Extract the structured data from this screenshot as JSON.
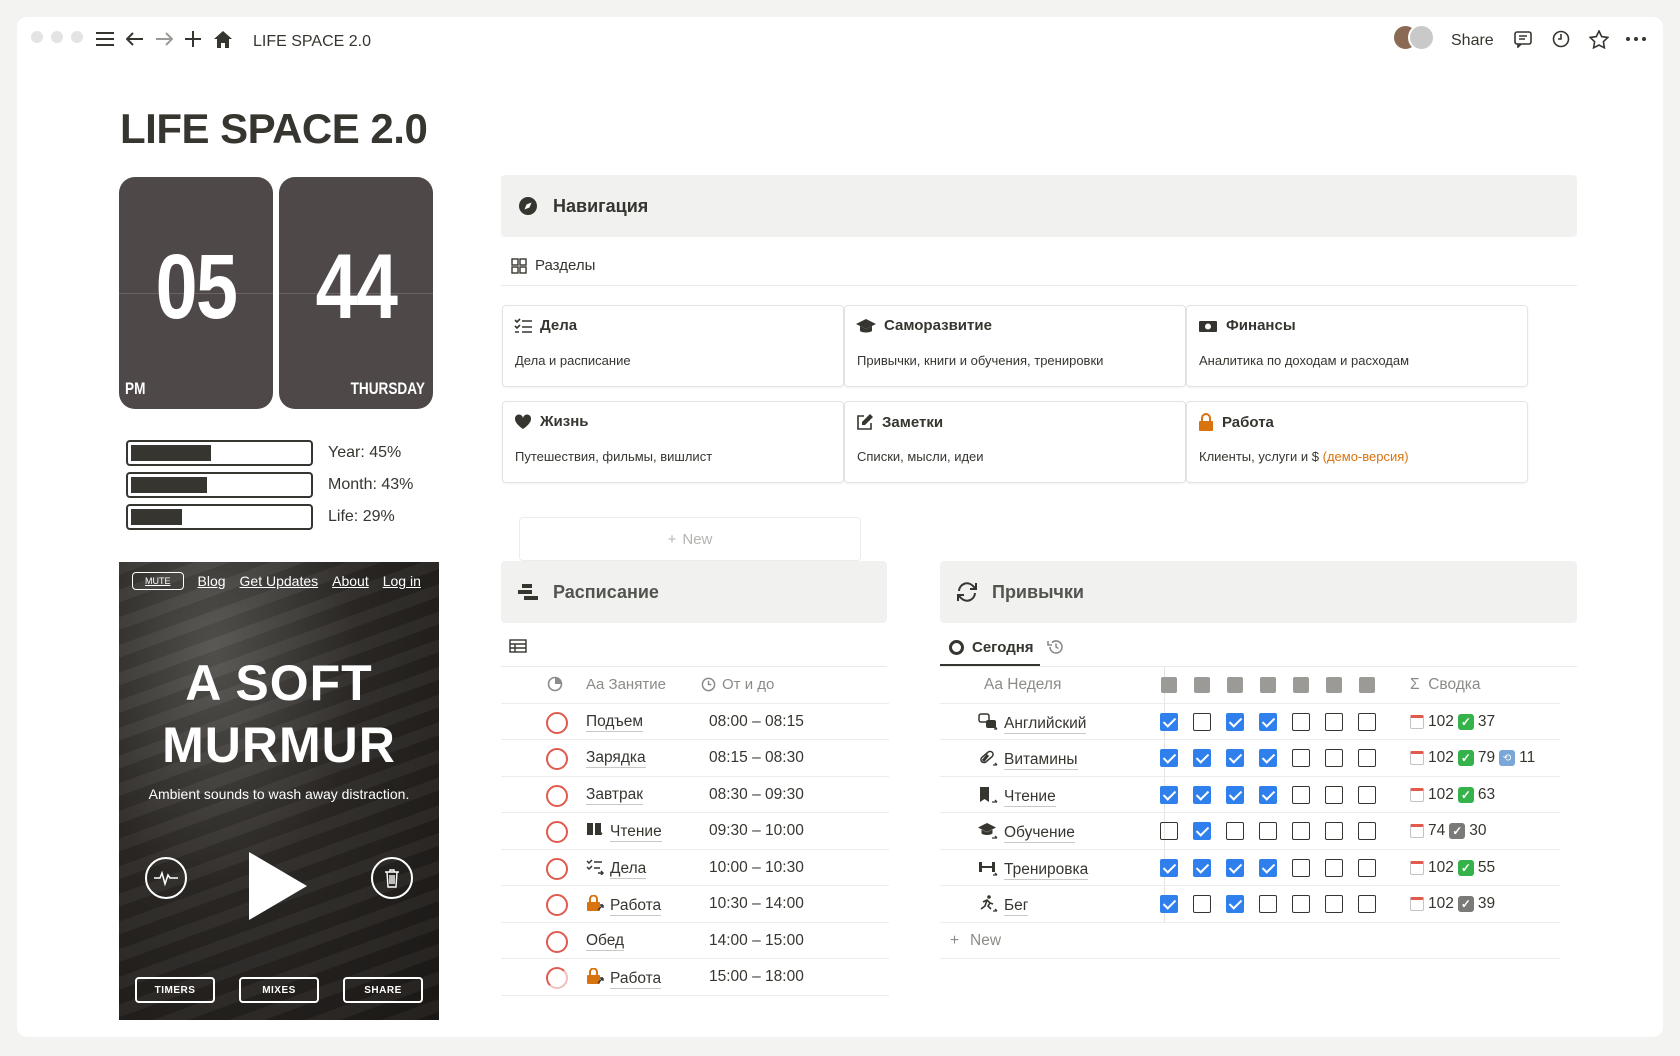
{
  "topbar": {
    "breadcrumb": "LIFE SPACE 2.0",
    "share": "Share"
  },
  "page": {
    "title": "LIFE SPACE 2.0"
  },
  "clock": {
    "hours": "05",
    "minutes": "44",
    "ampm": "PM",
    "day": "THURSDAY"
  },
  "progress": [
    {
      "label": "Year: 45%",
      "value": 0.45
    },
    {
      "label": "Month: 43%",
      "value": 0.43
    },
    {
      "label": "Life: 29%",
      "value": 0.29
    }
  ],
  "murmur": {
    "mute": "MUTE",
    "links": [
      "Blog",
      "Get Updates",
      "About",
      "Log in"
    ],
    "title_line1": "A SOFT",
    "title_line2": "MURMUR",
    "subtitle": "Ambient sounds to wash away distraction.",
    "buttons": [
      "TIMERS",
      "MIXES",
      "SHARE"
    ]
  },
  "navigation": {
    "title": "Навигация",
    "sections_label": "Разделы",
    "cards": [
      {
        "title": "Дела",
        "desc": "Дела и расписание",
        "icon": "checklist-icon"
      },
      {
        "title": "Саморазвитие",
        "desc": "Привычки, книги и обучения, тренировки",
        "icon": "graduation-cap-icon"
      },
      {
        "title": "Финансы",
        "desc": "Аналитика по доходам и расходам",
        "icon": "money-icon"
      },
      {
        "title": "Жизнь",
        "desc": "Путешествия, фильмы, вишлист",
        "icon": "heart-icon"
      },
      {
        "title": "Заметки",
        "desc": "Списки, мысли, идеи",
        "icon": "edit-icon"
      },
      {
        "title": "Работа",
        "desc": "Клиенты, услуги и $ ",
        "desc_extra": "(демо-версия)",
        "icon": "lock-icon"
      }
    ],
    "new_label": "New",
    "accent_orange": "#d9730d"
  },
  "schedule": {
    "title": "Расписание",
    "col_name": "Занятие",
    "col_name_prefix": "Aa",
    "col_time": "От и до",
    "rows": [
      {
        "name": "Подъем",
        "time": "08:00 – 08:15",
        "icon": ""
      },
      {
        "name": "Зарядка",
        "time": "08:15 – 08:30",
        "icon": ""
      },
      {
        "name": "Завтрак",
        "time": "08:30 – 09:30",
        "icon": ""
      },
      {
        "name": "Чтение",
        "time": "09:30 – 10:00",
        "icon": "book-link-icon"
      },
      {
        "name": "Дела",
        "time": "10:00 – 10:30",
        "icon": "checklist-link-icon"
      },
      {
        "name": "Работа",
        "time": "10:30 – 14:00",
        "icon": "lock-link-icon"
      },
      {
        "name": "Обед",
        "time": "14:00 – 15:00",
        "icon": ""
      },
      {
        "name": "Работа",
        "time": "15:00 – 18:00",
        "icon": "lock-link-icon"
      }
    ],
    "status_color": "#e05a4e"
  },
  "habits": {
    "title": "Привычки",
    "tab_today": "Сегодня",
    "col_week_prefix": "Aa",
    "col_week": "Неделя",
    "col_summary": "Сводка",
    "col_summary_prefix": "Σ",
    "rows": [
      {
        "name": "Английский",
        "checks": [
          true,
          false,
          true,
          true,
          false,
          false,
          false
        ],
        "s1": "102",
        "s2": "37",
        "s2type": "green",
        "s3": ""
      },
      {
        "name": "Витамины",
        "checks": [
          true,
          true,
          true,
          true,
          false,
          false,
          false
        ],
        "s1": "102",
        "s2": "79",
        "s2type": "green",
        "s3": "11"
      },
      {
        "name": "Чтение",
        "checks": [
          true,
          true,
          true,
          true,
          false,
          false,
          false
        ],
        "s1": "102",
        "s2": "63",
        "s2type": "green",
        "s3": ""
      },
      {
        "name": "Обучение",
        "checks": [
          false,
          true,
          false,
          false,
          false,
          false,
          false
        ],
        "s1": "74",
        "s2": "30",
        "s2type": "grey",
        "s3": ""
      },
      {
        "name": "Тренировка",
        "checks": [
          true,
          true,
          true,
          true,
          false,
          false,
          false
        ],
        "s1": "102",
        "s2": "55",
        "s2type": "green",
        "s3": ""
      },
      {
        "name": "Бег",
        "checks": [
          true,
          false,
          true,
          false,
          false,
          false,
          false
        ],
        "s1": "102",
        "s2": "39",
        "s2type": "grey",
        "s3": ""
      }
    ],
    "new_label": "New",
    "checkbox_color": "#2f80ed"
  }
}
